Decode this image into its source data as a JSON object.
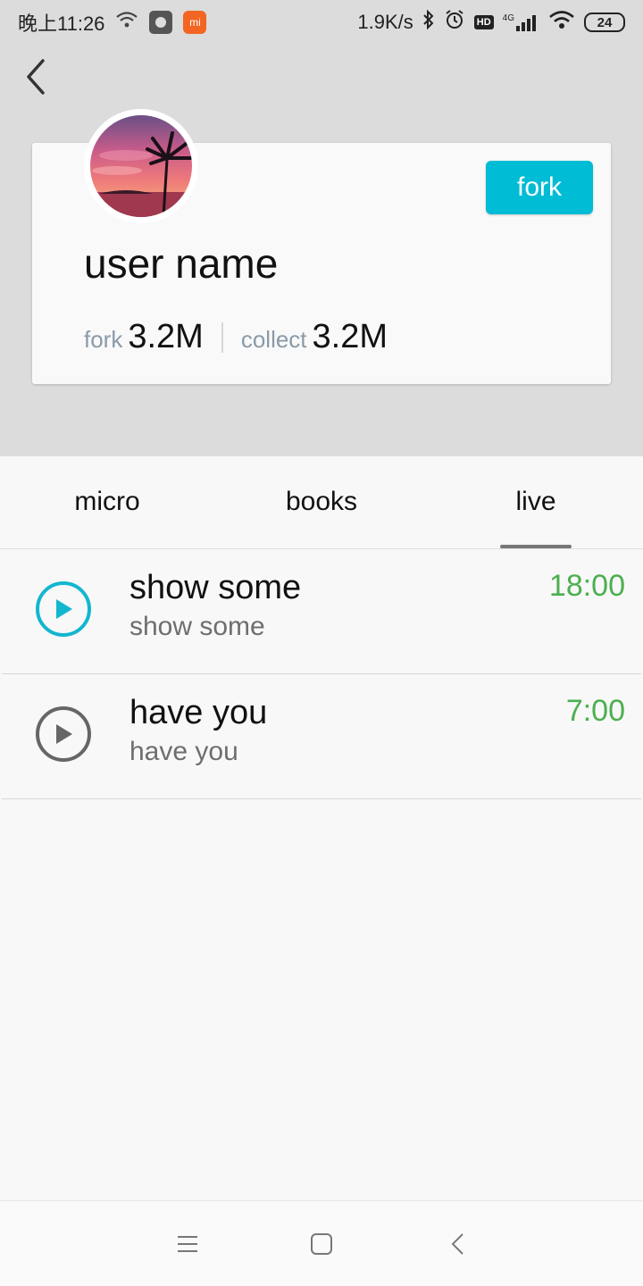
{
  "status_bar": {
    "time": "晚上11:26",
    "network_speed": "1.9K/s",
    "hd_label": "HD",
    "signal_label": "4G",
    "battery": "24"
  },
  "profile": {
    "username": "user name",
    "fork_button_label": "fork",
    "stats": [
      {
        "label": "fork",
        "value": "3.2M"
      },
      {
        "label": "collect",
        "value": "3.2M"
      }
    ]
  },
  "tabs": [
    {
      "label": "micro",
      "selected": false
    },
    {
      "label": "books",
      "selected": false
    },
    {
      "label": "live",
      "selected": true
    }
  ],
  "list": [
    {
      "title": "show some",
      "subtitle": "show some",
      "time": "18:00",
      "playing": true
    },
    {
      "title": "have you",
      "subtitle": "have you",
      "time": "7:00",
      "playing": false
    }
  ],
  "colors": {
    "accent": "#00bcd4",
    "time": "#4caf50",
    "header_bg": "#dcdcdc"
  }
}
